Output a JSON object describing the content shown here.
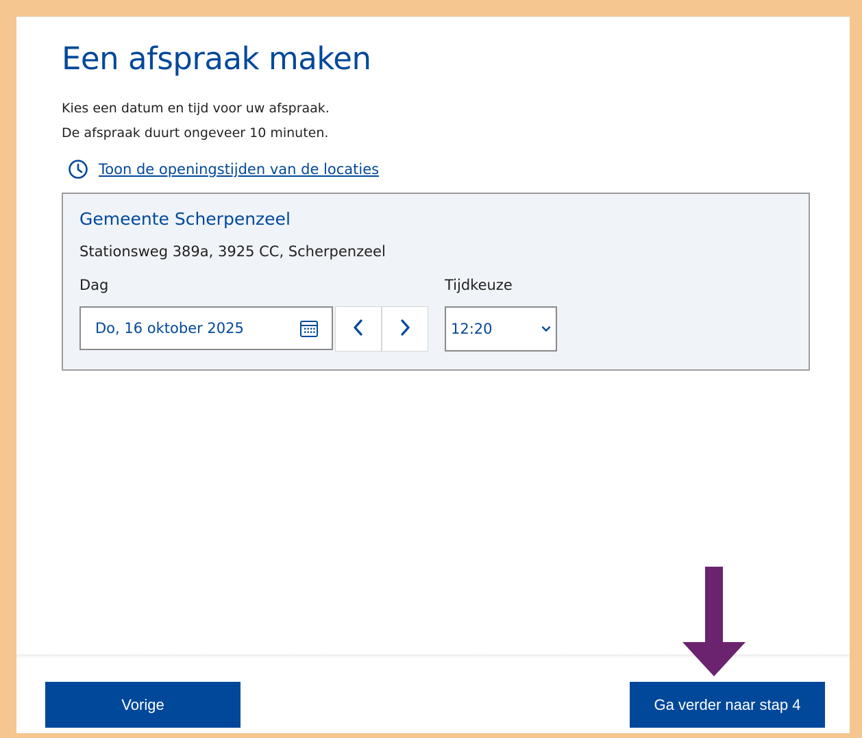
{
  "page": {
    "title": "Een afspraak maken",
    "intro_line_1": "Kies een datum en tijd voor uw afspraak.",
    "intro_line_2": "De afspraak duurt ongeveer 10 minuten.",
    "opening_hours_link": "Toon de openingstijden van de locaties"
  },
  "location": {
    "name": "Gemeente Scherpenzeel",
    "address": "Stationsweg 389a, 3925 CC, Scherpenzeel",
    "day_label": "Dag",
    "time_label": "Tijdkeuze",
    "selected_date": "Do, 16 oktober 2025",
    "selected_time": "12:20"
  },
  "footer": {
    "previous_label": "Vorige",
    "next_label": "Ga verder naar stap 4"
  },
  "icons": {
    "clock": "clock-icon",
    "calendar": "calendar-icon",
    "prev": "chevron-left-icon",
    "next": "chevron-right-icon",
    "dropdown": "chevron-down-icon",
    "annotation": "arrow-down-icon"
  },
  "colors": {
    "brand_blue": "#01489a",
    "frame_orange": "#f5c690",
    "card_background": "#f0f4f8",
    "annotation_arrow": "#6b2370"
  }
}
